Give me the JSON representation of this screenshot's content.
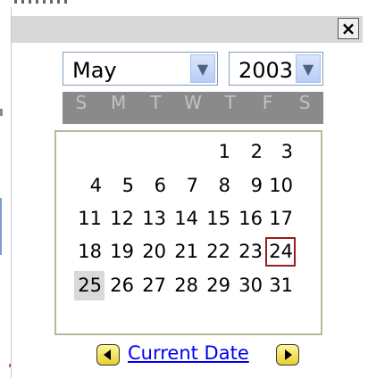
{
  "close_label": "×",
  "month": {
    "value": "May",
    "arrow": "chevron-down-icon"
  },
  "year": {
    "value": "2003",
    "arrow": "chevron-down-icon"
  },
  "weekdays": [
    "S",
    "M",
    "T",
    "W",
    "T",
    "F",
    "S"
  ],
  "weeks": [
    [
      "",
      "",
      "",
      "",
      "1",
      "2",
      "3"
    ],
    [
      "4",
      "5",
      "6",
      "7",
      "8",
      "9",
      "10"
    ],
    [
      "11",
      "12",
      "13",
      "14",
      "15",
      "16",
      "17"
    ],
    [
      "18",
      "19",
      "20",
      "21",
      "22",
      "23",
      "24"
    ],
    [
      "25",
      "26",
      "27",
      "28",
      "29",
      "30",
      "31"
    ]
  ],
  "today": "24",
  "selected": "25",
  "footer": {
    "current_date_label": "Current Date"
  },
  "colors": {
    "weekday_bar": "#8a8a8a",
    "today_border": "#9a1c1c",
    "selected_bg": "#d9d9d9",
    "link": "#0000ee",
    "nav_button": "#f5e35a"
  }
}
